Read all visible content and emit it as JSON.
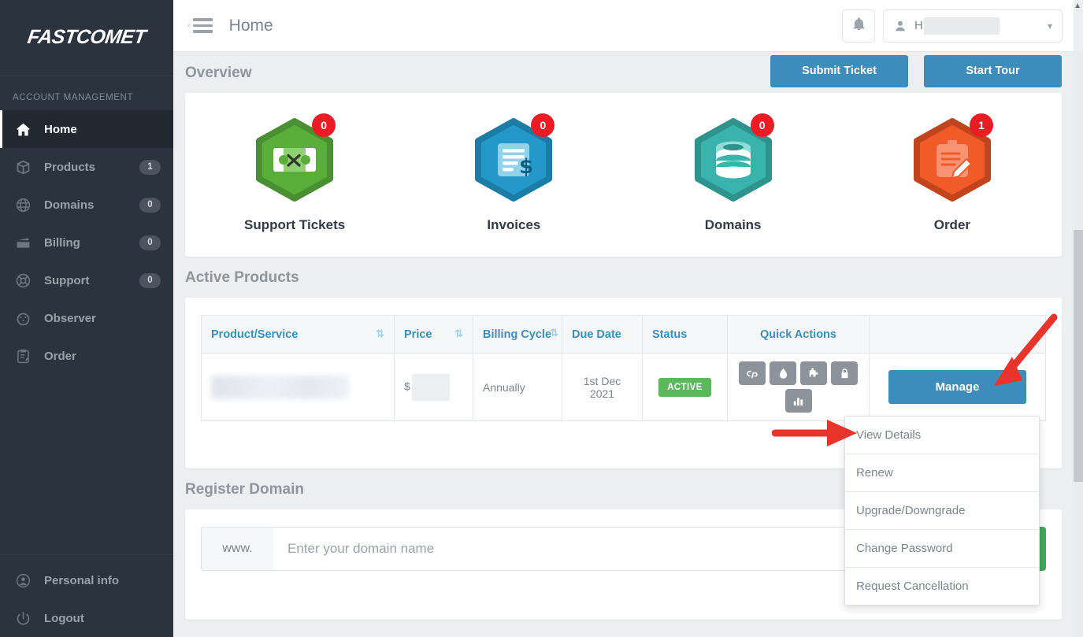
{
  "brand": {
    "logo_text": "FASTCOMET",
    "accent_blue": "#3c8dbc",
    "dark_bg": "#2b333e"
  },
  "sidebar": {
    "section_label": "ACCOUNT MANAGEMENT",
    "items": [
      {
        "label": "Home",
        "icon": "home-icon",
        "badge": "",
        "active": true
      },
      {
        "label": "Products",
        "icon": "box-icon",
        "badge": "1",
        "active": false
      },
      {
        "label": "Domains",
        "icon": "globe-icon",
        "badge": "0",
        "active": false
      },
      {
        "label": "Billing",
        "icon": "credit-card-icon",
        "badge": "0",
        "active": false
      },
      {
        "label": "Support",
        "icon": "lifebuoy-icon",
        "badge": "0",
        "active": false
      },
      {
        "label": "Observer",
        "icon": "gauge-icon",
        "badge": "",
        "active": false
      },
      {
        "label": "Order",
        "icon": "clipboard-pencil-icon",
        "badge": "",
        "active": false
      }
    ],
    "bottom_items": [
      {
        "label": "Personal info",
        "icon": "user-circle-icon"
      },
      {
        "label": "Logout",
        "icon": "power-icon"
      }
    ]
  },
  "topbar": {
    "page_title": "Home",
    "menu_icon": "hamburger-icon",
    "collapse_icon": "chevron-left-icon",
    "notifications_icon": "bell-icon",
    "user_icon": "user-icon",
    "user_name_prefix": "H",
    "user_name_redacted": true,
    "dropdown_icon": "chevron-down-icon"
  },
  "overview": {
    "heading": "Overview",
    "submit_ticket_label": "Submit Ticket",
    "start_tour_label": "Start Tour",
    "tiles": [
      {
        "label": "Support Tickets",
        "count": "0",
        "color": "#5aae3c",
        "dark": "#4a8f31",
        "icon": "ticket-tools-icon"
      },
      {
        "label": "Invoices",
        "count": "0",
        "color": "#2398c9",
        "dark": "#1b7ca6",
        "icon": "invoice-dollar-icon"
      },
      {
        "label": "Domains",
        "count": "0",
        "color": "#3bb3ad",
        "dark": "#2e928d",
        "icon": "database-icon"
      },
      {
        "label": "Order",
        "count": "1",
        "color": "#f15a29",
        "dark": "#c2441c",
        "icon": "clipboard-pencil-icon"
      }
    ],
    "badge_color": "#ec1c24"
  },
  "active_products": {
    "heading": "Active Products",
    "columns": [
      {
        "label": "Product/Service",
        "sort": "sort-desc-icon"
      },
      {
        "label": "Price",
        "sort": "sort-both-icon"
      },
      {
        "label": "Billing Cycle",
        "sort": "sort-both-icon"
      },
      {
        "label": "Due Date",
        "sort": ""
      },
      {
        "label": "Status",
        "sort": ""
      },
      {
        "label": "Quick Actions",
        "sort": ""
      },
      {
        "label": "",
        "sort": ""
      }
    ],
    "rows": [
      {
        "product": "",
        "product_redacted": true,
        "price_symbol": "$",
        "price_redacted": true,
        "billing_cycle": "Annually",
        "due_date_line1": "1st Dec",
        "due_date_line2": "2021",
        "status": "ACTIVE",
        "status_color": "#5cb85c",
        "quick_actions": [
          "cpanel-icon",
          "water-drop-icon",
          "puzzle-piece-icon",
          "lock-icon",
          "bar-chart-icon"
        ],
        "manage_label": "Manage"
      }
    ],
    "manage_menu": [
      "View Details",
      "Renew",
      "Upgrade/Downgrade",
      "Change Password",
      "Request Cancellation"
    ]
  },
  "register_domain": {
    "heading": "Register Domain",
    "prefix_label": "www.",
    "input_placeholder": "Enter your domain name",
    "input_value": "",
    "search_button_color": "#42a85c"
  },
  "annotations": [
    {
      "name": "arrow-to-manage-button",
      "color": "#e8342a",
      "direction": "down-left"
    },
    {
      "name": "arrow-to-view-details",
      "color": "#e8342a",
      "direction": "right"
    }
  ]
}
